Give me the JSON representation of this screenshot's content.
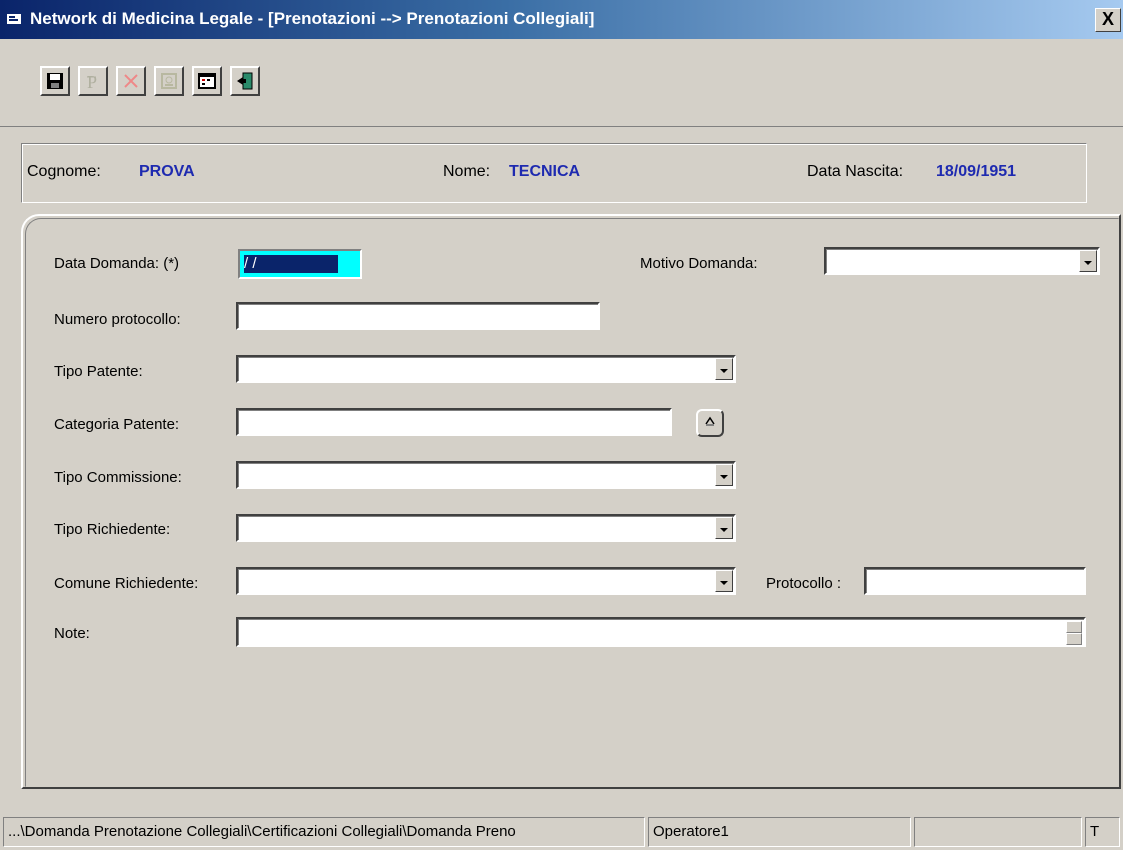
{
  "window": {
    "title": "Network di Medicina Legale - [Prenotazioni --> Prenotazioni Collegiali]",
    "close_label": "X"
  },
  "toolbar": {
    "buttons": [
      {
        "name": "save-icon"
      },
      {
        "name": "print-icon"
      },
      {
        "name": "delete-icon"
      },
      {
        "name": "certificate-icon"
      },
      {
        "name": "calendar-icon"
      },
      {
        "name": "exit-door-icon"
      }
    ]
  },
  "patient": {
    "surname_label": "Cognome:",
    "surname": "PROVA",
    "name_label": "Nome:",
    "name": "TECNICA",
    "birth_label": "Data Nascita:",
    "birth_date": "18/09/1951"
  },
  "form": {
    "data_domanda_label": "Data Domanda: (*)",
    "data_domanda_value": " /  /",
    "motivo_label": "Motivo Domanda:",
    "motivo_value": "",
    "protocollo_num_label": "Numero protocollo:",
    "protocollo_num_value": "",
    "tipo_patente_label": "Tipo Patente:",
    "tipo_patente_value": "",
    "categoria_patente_label": "Categoria Patente:",
    "categoria_patente_value": "",
    "tipo_commissione_label": "Tipo Commissione:",
    "tipo_commissione_value": "",
    "tipo_richiedente_label": "Tipo Richiedente:",
    "tipo_richiedente_value": "",
    "comune_label": "Comune Richiedente:",
    "comune_value": "",
    "protocollo_label": "Protocollo :",
    "protocollo_value": "",
    "note_label": "Note:",
    "note_value": ""
  },
  "statusbar": {
    "path": "...\\Domanda Prenotazione Collegiali\\Certificazioni Collegiali\\Domanda Preno",
    "operator": "Operatore1",
    "empty": "",
    "t": "T"
  },
  "colors": {
    "accent": "#1e2ab0",
    "title_bar": "#0a246a",
    "date_highlight": "#00ffff"
  }
}
